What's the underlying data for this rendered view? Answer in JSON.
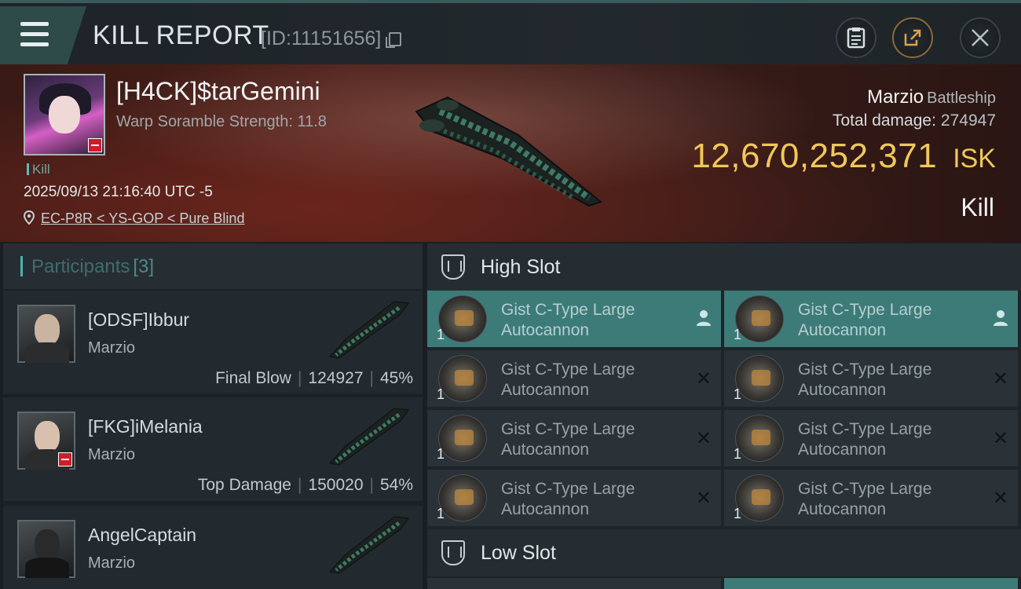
{
  "topbar": {
    "title": "KILL REPORT",
    "report_id": "[ID:11151656]",
    "buttons": [
      "clipboard",
      "share",
      "close"
    ]
  },
  "victim": {
    "name": "[H4CK]$tarGemini",
    "warp_scramble": "Warp Soramble Strength: 11.8",
    "tag": "Kill",
    "datetime": "2025/09/13 21:16:40 UTC -5",
    "location": "EC-P8R < YS-GOP < Pure Blind",
    "ship": "Marzio",
    "ship_class": "Battleship",
    "total_damage_label": "Total damage:",
    "total_damage": "274947",
    "isk_value": "12,670,252,371",
    "isk_unit": "ISK",
    "result": "Kill"
  },
  "participants": {
    "label": "Participants",
    "count": "[3]",
    "items": [
      {
        "name": "[ODSF]Ibbur",
        "ship": "Marzio",
        "role": "Final Blow",
        "damage": "124927",
        "percent": "45%"
      },
      {
        "name": "[FKG]iMelania",
        "ship": "Marzio",
        "role": "Top Damage",
        "damage": "150020",
        "percent": "54%"
      },
      {
        "name": "AngelCaptain",
        "ship": "Marzio",
        "role": "",
        "damage": "",
        "percent": ""
      }
    ]
  },
  "high_slot": {
    "label": "High Slot",
    "modules": [
      {
        "line1": "Gist C-Type Large",
        "line2": "Autocannon",
        "qty": "1",
        "state": "active"
      },
      {
        "line1": "Gist C-Type Large",
        "line2": "Autocannon",
        "qty": "1",
        "state": "active"
      },
      {
        "line1": "Gist C-Type Large",
        "line2": "Autocannon",
        "qty": "1",
        "state": "destroyed"
      },
      {
        "line1": "Gist C-Type Large",
        "line2": "Autocannon",
        "qty": "1",
        "state": "destroyed"
      },
      {
        "line1": "Gist C-Type Large",
        "line2": "Autocannon",
        "qty": "1",
        "state": "destroyed"
      },
      {
        "line1": "Gist C-Type Large",
        "line2": "Autocannon",
        "qty": "1",
        "state": "destroyed"
      },
      {
        "line1": "Gist C-Type Large",
        "line2": "Autocannon",
        "qty": "1",
        "state": "destroyed"
      },
      {
        "line1": "Gist C-Type Large",
        "line2": "Autocannon",
        "qty": "1",
        "state": "destroyed"
      }
    ]
  },
  "low_slot": {
    "label": "Low Slot"
  },
  "icons": {
    "menu": "menu-icon",
    "clipboard": "clipboard-icon",
    "share": "share-icon",
    "close": "close-icon",
    "pin": "location-pin-icon",
    "slot": "shield-slot-icon"
  },
  "colors": {
    "accent": "#4fb1ac",
    "isk": "#f0c85a",
    "active_module": "#3d7b79",
    "danger": "#c8202a"
  }
}
